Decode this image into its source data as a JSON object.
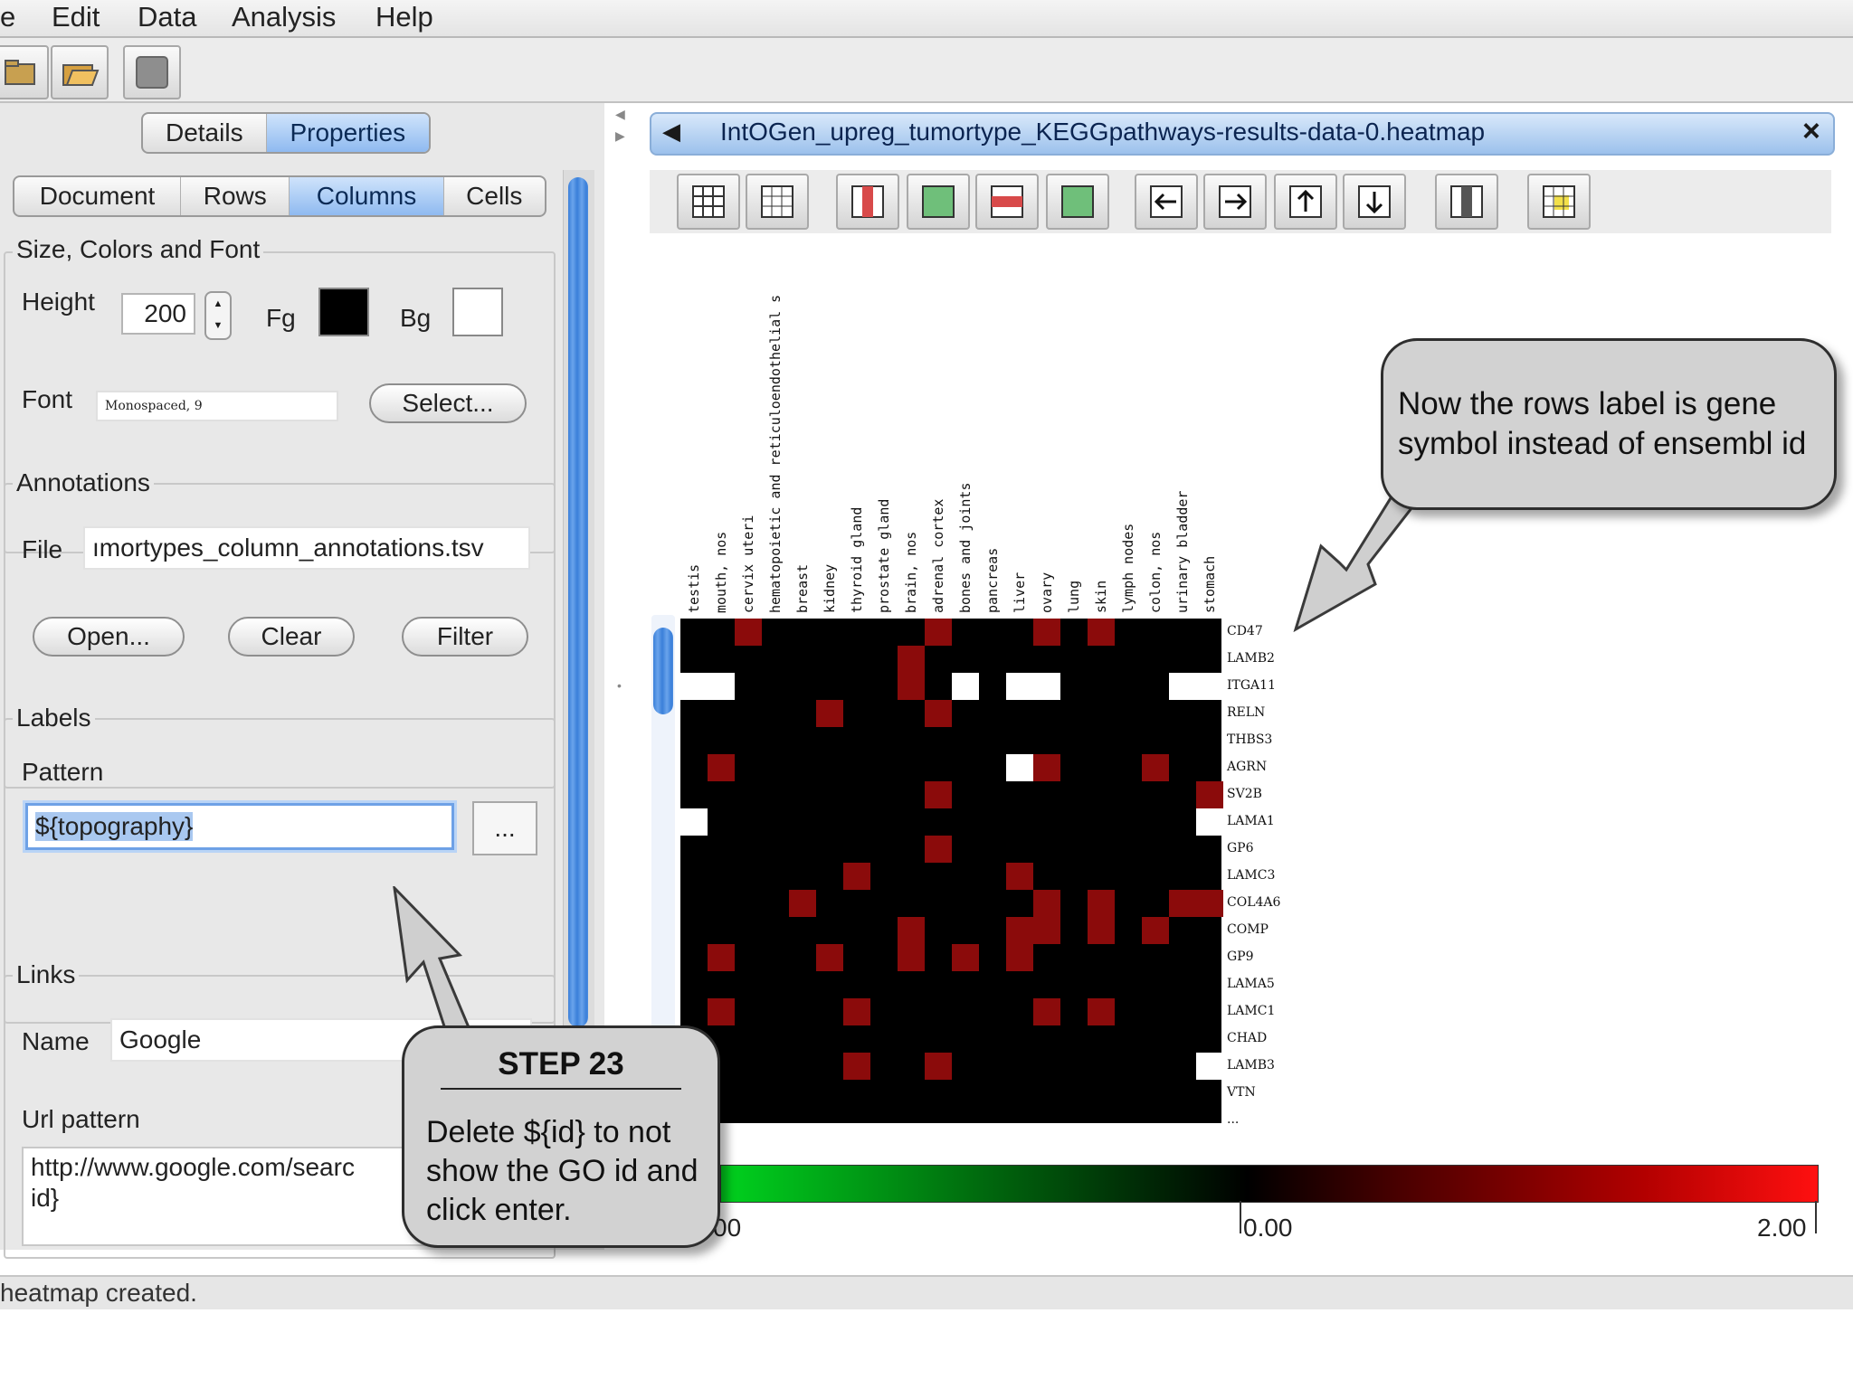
{
  "menu": [
    "e",
    "Edit",
    "Data",
    "Analysis",
    "Help"
  ],
  "left_panel": {
    "top_tabs": [
      "Details",
      "Properties"
    ],
    "top_tab_selected": "Properties",
    "sub_tabs": [
      "Document",
      "Rows",
      "Columns",
      "Cells"
    ],
    "sub_tab_selected": "Columns",
    "size_group": {
      "title": "Size, Colors and Font",
      "height_label": "Height",
      "height_value": "200",
      "fg_label": "Fg",
      "fg_color": "#000000",
      "bg_label": "Bg",
      "bg_color": "#ffffff",
      "font_label": "Font",
      "font_value": "Monospaced, 9",
      "select_button": "Select..."
    },
    "annotations_group": {
      "title": "Annotations",
      "file_label": "File",
      "file_value": "ımortypes_column_annotations.tsv",
      "open_button": "Open...",
      "clear_button": "Clear",
      "filter_button": "Filter"
    },
    "labels_group": {
      "title": "Labels",
      "pattern_label": "Pattern",
      "pattern_value": "${topography}",
      "more_button": "..."
    },
    "links_group": {
      "title": "Links",
      "name_label": "Name",
      "name_value": "Google",
      "url_label": "Url pattern",
      "url_value_line1": "http://www.google.com/searc",
      "url_value_line2": "id}"
    }
  },
  "document_tab": {
    "title": "IntOGen_upreg_tumortype_KEGGpathways-results-data-0.heatmap",
    "close": "×"
  },
  "heatmap": {
    "columns": [
      "testis",
      "mouth, nos",
      "cervix uteri",
      "hematopoietic and reticuloendothelial s",
      "breast",
      "kidney",
      "thyroid gland",
      "prostate gland",
      "brain, nos",
      "adrenal cortex",
      "bones and joints",
      "pancreas",
      "liver",
      "ovary",
      "lung",
      "skin",
      "lymph nodes",
      "colon, nos",
      "urinary bladder",
      "stomach"
    ],
    "rows": [
      "CD47",
      "LAMB2",
      "ITGA11",
      "RELN",
      "THBS3",
      "AGRN",
      "SV2B",
      "LAMA1",
      "GP6",
      "LAMC3",
      "COL4A6",
      "COMP",
      "GP9",
      "LAMA5",
      "LAMC1",
      "CHAD",
      "LAMB3",
      "VTN",
      "..."
    ],
    "colors": {
      "black": "#000000",
      "red": "#8b0b0b",
      "white": "#ffffff"
    },
    "red_cells": [
      [
        0,
        2
      ],
      [
        0,
        9
      ],
      [
        0,
        13
      ],
      [
        0,
        15
      ],
      [
        1,
        8
      ],
      [
        2,
        8
      ],
      [
        3,
        5
      ],
      [
        3,
        9
      ],
      [
        5,
        1
      ],
      [
        5,
        13
      ],
      [
        5,
        17
      ],
      [
        6,
        9
      ],
      [
        6,
        19
      ],
      [
        8,
        9
      ],
      [
        9,
        6
      ],
      [
        9,
        12
      ],
      [
        10,
        4
      ],
      [
        10,
        13
      ],
      [
        10,
        15
      ],
      [
        10,
        18
      ],
      [
        10,
        19
      ],
      [
        11,
        8
      ],
      [
        11,
        12
      ],
      [
        11,
        13
      ],
      [
        11,
        15
      ],
      [
        11,
        17
      ],
      [
        12,
        1
      ],
      [
        12,
        5
      ],
      [
        12,
        8
      ],
      [
        12,
        10
      ],
      [
        12,
        12
      ],
      [
        14,
        1
      ],
      [
        14,
        6
      ],
      [
        14,
        13
      ],
      [
        14,
        15
      ],
      [
        16,
        6
      ],
      [
        16,
        9
      ]
    ],
    "white_cells": [
      [
        2,
        0
      ],
      [
        2,
        1
      ],
      [
        2,
        10
      ],
      [
        2,
        12
      ],
      [
        2,
        13
      ],
      [
        2,
        18
      ],
      [
        2,
        19
      ],
      [
        5,
        12
      ],
      [
        7,
        0
      ],
      [
        7,
        19
      ],
      [
        16,
        19
      ]
    ],
    "colorbar": {
      "labels": [
        "00",
        "0.00",
        "2.00"
      ]
    }
  },
  "status": "heatmap created.",
  "callouts": {
    "rows": "Now the rows label is gene symbol instead of ensembl id",
    "step_title": "STEP 23",
    "step_text": "Delete ${id} to not show the GO id and click enter."
  }
}
